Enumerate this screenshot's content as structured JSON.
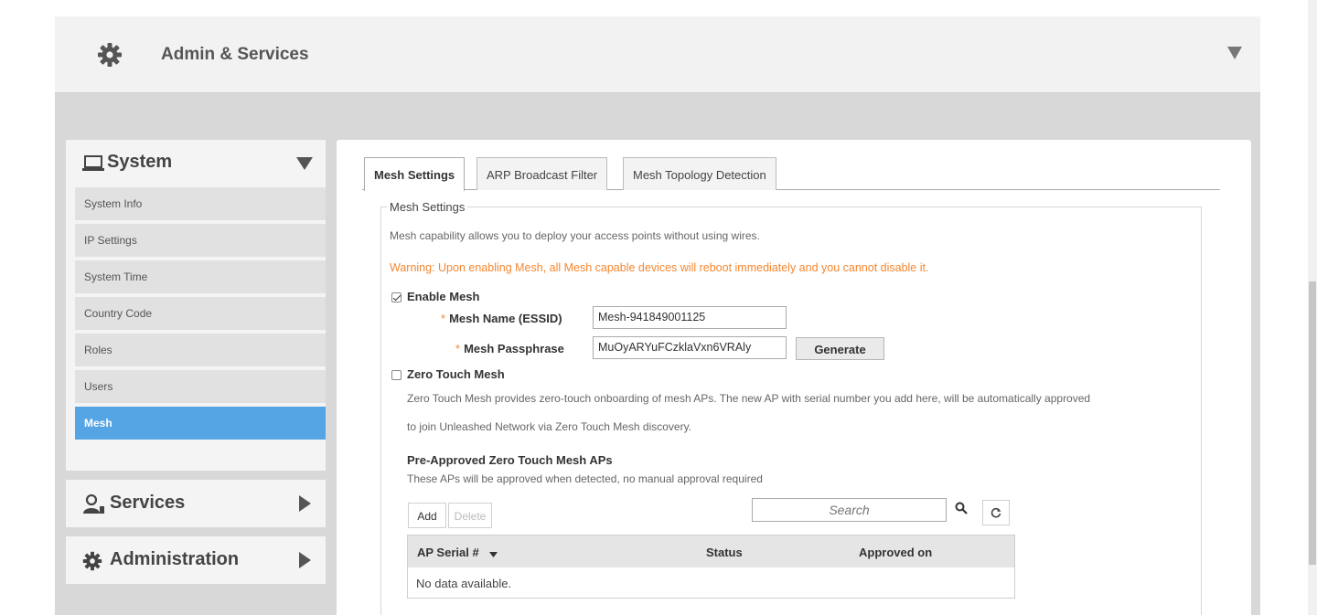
{
  "header": {
    "title": "Admin & Services"
  },
  "sidebar": {
    "system": {
      "title": "System",
      "items": [
        {
          "label": "System Info"
        },
        {
          "label": "IP Settings"
        },
        {
          "label": "System Time"
        },
        {
          "label": "Country Code"
        },
        {
          "label": "Roles"
        },
        {
          "label": "Users"
        },
        {
          "label": "Mesh",
          "active": true
        }
      ]
    },
    "services": {
      "title": "Services"
    },
    "administration": {
      "title": "Administration"
    }
  },
  "tabs": [
    {
      "label": "Mesh Settings",
      "active": true
    },
    {
      "label": "ARP Broadcast Filter"
    },
    {
      "label": "Mesh Topology Detection"
    }
  ],
  "mesh": {
    "legend": "Mesh Settings",
    "description": "Mesh capability allows you to deploy your access points without using wires.",
    "warning": "Warning: Upon enabling Mesh, all Mesh capable devices will reboot immediately and you cannot disable it.",
    "enable_label": "Enable Mesh",
    "enable_checked": true,
    "required_mark": "*",
    "name_label": "Mesh Name (ESSID)",
    "name_value": "Mesh-941849001125",
    "pass_label": "Mesh Passphrase",
    "pass_value": "MuOyARYuFCzklaVxn6VRAly",
    "generate_label": "Generate",
    "ztm_label": "Zero Touch Mesh",
    "ztm_checked": false,
    "ztm_desc_1": "Zero Touch Mesh provides zero-touch onboarding of mesh APs. The new AP with serial number you add here, will be automatically approved",
    "ztm_desc_2": "to join Unleashed Network via Zero Touch Mesh discovery.",
    "preapproved_title": "Pre-Approved Zero Touch Mesh APs",
    "preapproved_desc": "These APs will be approved when detected, no manual approval required",
    "add_label": "Add",
    "delete_label": "Delete",
    "search_placeholder": "Search",
    "table": {
      "columns": [
        "AP Serial #",
        "Status",
        "Approved on"
      ],
      "empty_text": "No data available."
    }
  },
  "colors": {
    "accent": "#55a4e3",
    "warning": "#f5872f"
  }
}
